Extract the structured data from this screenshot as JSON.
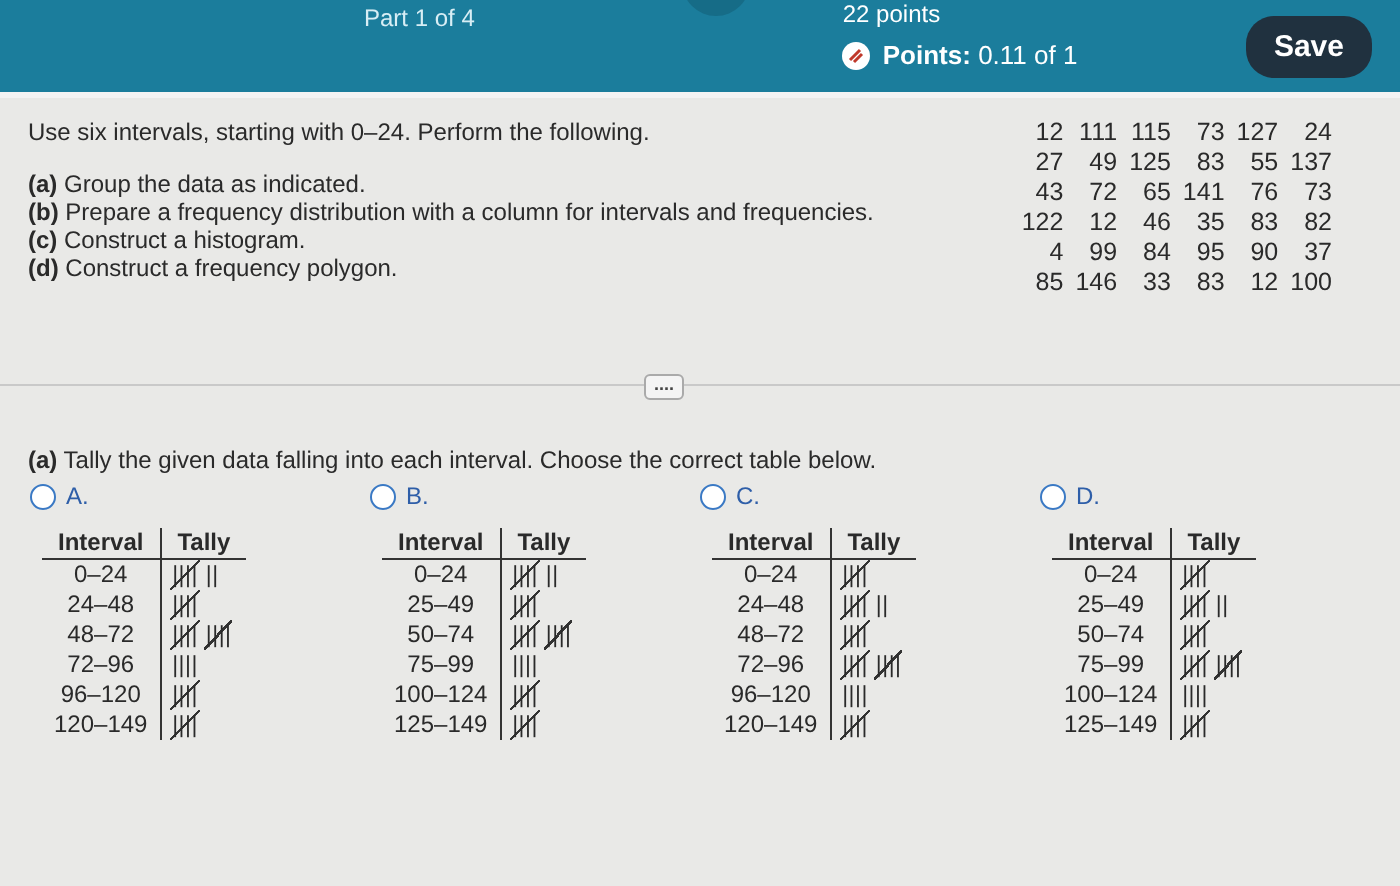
{
  "header": {
    "part": "Part 1 of 4",
    "points_total": "22 points",
    "points_label": "Points:",
    "points_value": "0.11 of 1",
    "save": "Save"
  },
  "instructions": "Use six intervals, starting with 0–24. Perform the following.",
  "tasks": [
    {
      "letter": "(a)",
      "text": "Group the data as indicated."
    },
    {
      "letter": "(b)",
      "text": "Prepare a frequency distribution with a column for intervals and frequencies."
    },
    {
      "letter": "(c)",
      "text": "Construct a histogram."
    },
    {
      "letter": "(d)",
      "text": "Construct a frequency polygon."
    }
  ],
  "data_rows": [
    [
      "12",
      "111",
      "115",
      "73",
      "127",
      "24"
    ],
    [
      "27",
      "49",
      "125",
      "83",
      "55",
      "137"
    ],
    [
      "43",
      "72",
      "65",
      "141",
      "76",
      "73"
    ],
    [
      "122",
      "12",
      "46",
      "35",
      "83",
      "82"
    ],
    [
      "4",
      "99",
      "84",
      "95",
      "90",
      "37"
    ],
    [
      "85",
      "146",
      "33",
      "83",
      "12",
      "100"
    ]
  ],
  "expand_button": "....",
  "question": "**(a)** Tally the given data falling into each interval. Choose the correct table below.",
  "options": [
    {
      "label": "A.",
      "selected": false,
      "columns": [
        "Interval",
        "Tally"
      ],
      "rows": [
        {
          "interval": "0–24",
          "tally": [
            {
              "kind": "five",
              "marks": "||||"
            },
            {
              "kind": "ones",
              "marks": "||"
            }
          ]
        },
        {
          "interval": "24–48",
          "tally": [
            {
              "kind": "five",
              "marks": "||||"
            }
          ]
        },
        {
          "interval": "48–72",
          "tally": [
            {
              "kind": "five",
              "marks": "||||"
            },
            {
              "kind": "five",
              "marks": "||||"
            }
          ]
        },
        {
          "interval": "72–96",
          "tally": [
            {
              "kind": "ones",
              "marks": "||||"
            }
          ]
        },
        {
          "interval": "96–120",
          "tally": [
            {
              "kind": "five",
              "marks": "||||"
            }
          ]
        },
        {
          "interval": "120–149",
          "tally": [
            {
              "kind": "five",
              "marks": "||||"
            }
          ]
        }
      ]
    },
    {
      "label": "B.",
      "selected": false,
      "columns": [
        "Interval",
        "Tally"
      ],
      "rows": [
        {
          "interval": "0–24",
          "tally": [
            {
              "kind": "five",
              "marks": "||||"
            },
            {
              "kind": "ones",
              "marks": "||"
            }
          ]
        },
        {
          "interval": "25–49",
          "tally": [
            {
              "kind": "five",
              "marks": "||||"
            }
          ]
        },
        {
          "interval": "50–74",
          "tally": [
            {
              "kind": "five",
              "marks": "||||"
            },
            {
              "kind": "five",
              "marks": "||||"
            }
          ]
        },
        {
          "interval": "75–99",
          "tally": [
            {
              "kind": "ones",
              "marks": "||||"
            }
          ]
        },
        {
          "interval": "100–124",
          "tally": [
            {
              "kind": "five",
              "marks": "||||"
            }
          ]
        },
        {
          "interval": "125–149",
          "tally": [
            {
              "kind": "five",
              "marks": "||||"
            }
          ]
        }
      ]
    },
    {
      "label": "C.",
      "selected": false,
      "columns": [
        "Interval",
        "Tally"
      ],
      "rows": [
        {
          "interval": "0–24",
          "tally": [
            {
              "kind": "five",
              "marks": "||||"
            }
          ]
        },
        {
          "interval": "24–48",
          "tally": [
            {
              "kind": "five",
              "marks": "||||"
            },
            {
              "kind": "ones",
              "marks": "||"
            }
          ]
        },
        {
          "interval": "48–72",
          "tally": [
            {
              "kind": "five",
              "marks": "||||"
            }
          ]
        },
        {
          "interval": "72–96",
          "tally": [
            {
              "kind": "five",
              "marks": "||||"
            },
            {
              "kind": "five",
              "marks": "||||"
            }
          ]
        },
        {
          "interval": "96–120",
          "tally": [
            {
              "kind": "ones",
              "marks": "||||"
            }
          ]
        },
        {
          "interval": "120–149",
          "tally": [
            {
              "kind": "five",
              "marks": "||||"
            }
          ]
        }
      ]
    },
    {
      "label": "D.",
      "selected": false,
      "columns": [
        "Interval",
        "Tally"
      ],
      "rows": [
        {
          "interval": "0–24",
          "tally": [
            {
              "kind": "five",
              "marks": "||||"
            }
          ]
        },
        {
          "interval": "25–49",
          "tally": [
            {
              "kind": "five",
              "marks": "||||"
            },
            {
              "kind": "ones",
              "marks": "||"
            }
          ]
        },
        {
          "interval": "50–74",
          "tally": [
            {
              "kind": "five",
              "marks": "||||"
            }
          ]
        },
        {
          "interval": "75–99",
          "tally": [
            {
              "kind": "five",
              "marks": "||||"
            },
            {
              "kind": "five",
              "marks": "||||"
            }
          ]
        },
        {
          "interval": "100–124",
          "tally": [
            {
              "kind": "ones",
              "marks": "||||"
            }
          ]
        },
        {
          "interval": "125–149",
          "tally": [
            {
              "kind": "five",
              "marks": "||||"
            }
          ]
        }
      ]
    }
  ]
}
